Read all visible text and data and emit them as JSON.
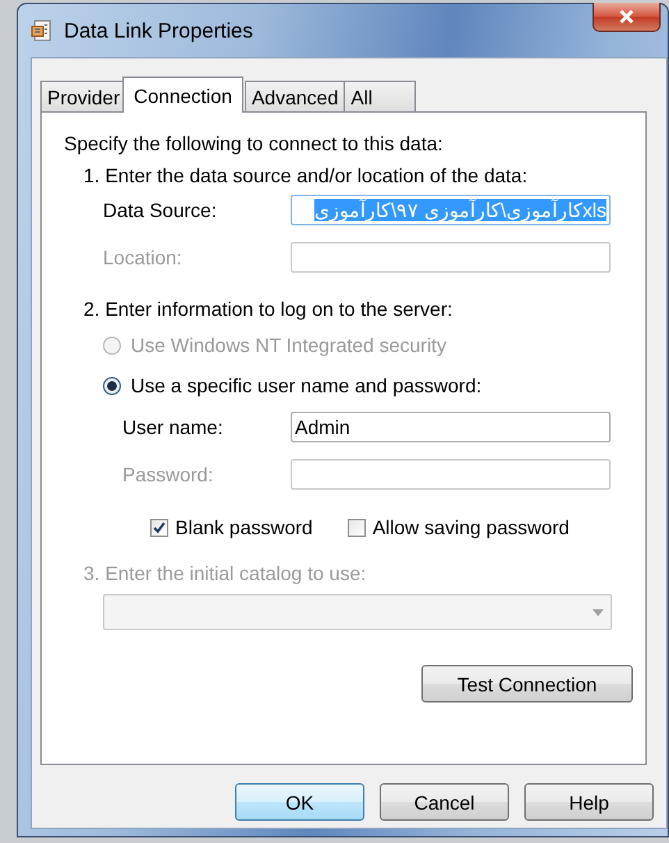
{
  "window": {
    "title": "Data Link Properties"
  },
  "tabs": [
    {
      "label": "Provider",
      "selected": false
    },
    {
      "label": "Connection",
      "selected": true
    },
    {
      "label": "Advanced",
      "selected": false
    },
    {
      "label": "All",
      "selected": false
    }
  ],
  "intro": "Specify the following to connect to this data:",
  "step1": {
    "heading": "1. Enter the data source and/or location of the data:",
    "fields": [
      {
        "label": "Data Source:",
        "value": "xlsکارآموزی\\کارآموزی ۹۷\\کارآموزی",
        "disabled": false,
        "text_selected": true
      },
      {
        "label": "Location:",
        "disabled": true
      }
    ]
  },
  "step2": {
    "heading": "2. Enter information to log on to the server:",
    "options": [
      {
        "label": "Use Windows NT Integrated security",
        "selected": false,
        "disabled": true
      },
      {
        "label": "Use a specific user name and password:",
        "selected": true,
        "disabled": false
      }
    ],
    "fields": [
      {
        "label": "User name:",
        "value": "Admin",
        "disabled": false,
        "text_selected": false
      },
      {
        "label": "Password:",
        "disabled": true
      }
    ],
    "checkboxes": [
      {
        "label": "Blank password",
        "checked": true
      },
      {
        "label": "Allow saving password",
        "checked": false
      }
    ]
  },
  "step3": {
    "heading": "3. Enter the initial catalog to use:",
    "disabled": true
  },
  "test_button": "Test Connection",
  "buttons": [
    {
      "label": "OK",
      "default": true
    },
    {
      "label": "Cancel",
      "default": false
    },
    {
      "label": "Help",
      "default": false
    }
  ]
}
